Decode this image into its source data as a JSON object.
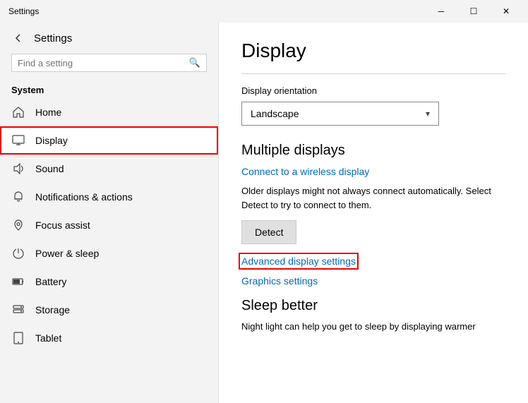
{
  "titleBar": {
    "title": "Settings",
    "minLabel": "─",
    "maxLabel": "☐",
    "closeLabel": "✕"
  },
  "sidebar": {
    "appTitle": "Settings",
    "search": {
      "placeholder": "Find a setting",
      "value": ""
    },
    "sectionLabel": "System",
    "navItems": [
      {
        "id": "home",
        "label": "Home",
        "icon": "home"
      },
      {
        "id": "display",
        "label": "Display",
        "icon": "display",
        "active": true
      },
      {
        "id": "sound",
        "label": "Sound",
        "icon": "sound"
      },
      {
        "id": "notifications",
        "label": "Notifications & actions",
        "icon": "notifications"
      },
      {
        "id": "focus",
        "label": "Focus assist",
        "icon": "focus"
      },
      {
        "id": "power",
        "label": "Power & sleep",
        "icon": "power"
      },
      {
        "id": "battery",
        "label": "Battery",
        "icon": "battery"
      },
      {
        "id": "storage",
        "label": "Storage",
        "icon": "storage"
      },
      {
        "id": "tablet",
        "label": "Tablet",
        "icon": "tablet"
      }
    ]
  },
  "content": {
    "pageTitle": "Display",
    "orientationLabel": "Display orientation",
    "orientationValue": "Landscape",
    "multipleDisplaysTitle": "Multiple displays",
    "wirelessLink": "Connect to a wireless display",
    "infoText": "Older displays might not always connect automatically. Select Detect to try to connect to them.",
    "detectBtn": "Detect",
    "advancedLink": "Advanced display settings",
    "graphicsLink": "Graphics settings",
    "sleepTitle": "Sleep better",
    "sleepText": "Night light can help you get to sleep by displaying warmer"
  }
}
